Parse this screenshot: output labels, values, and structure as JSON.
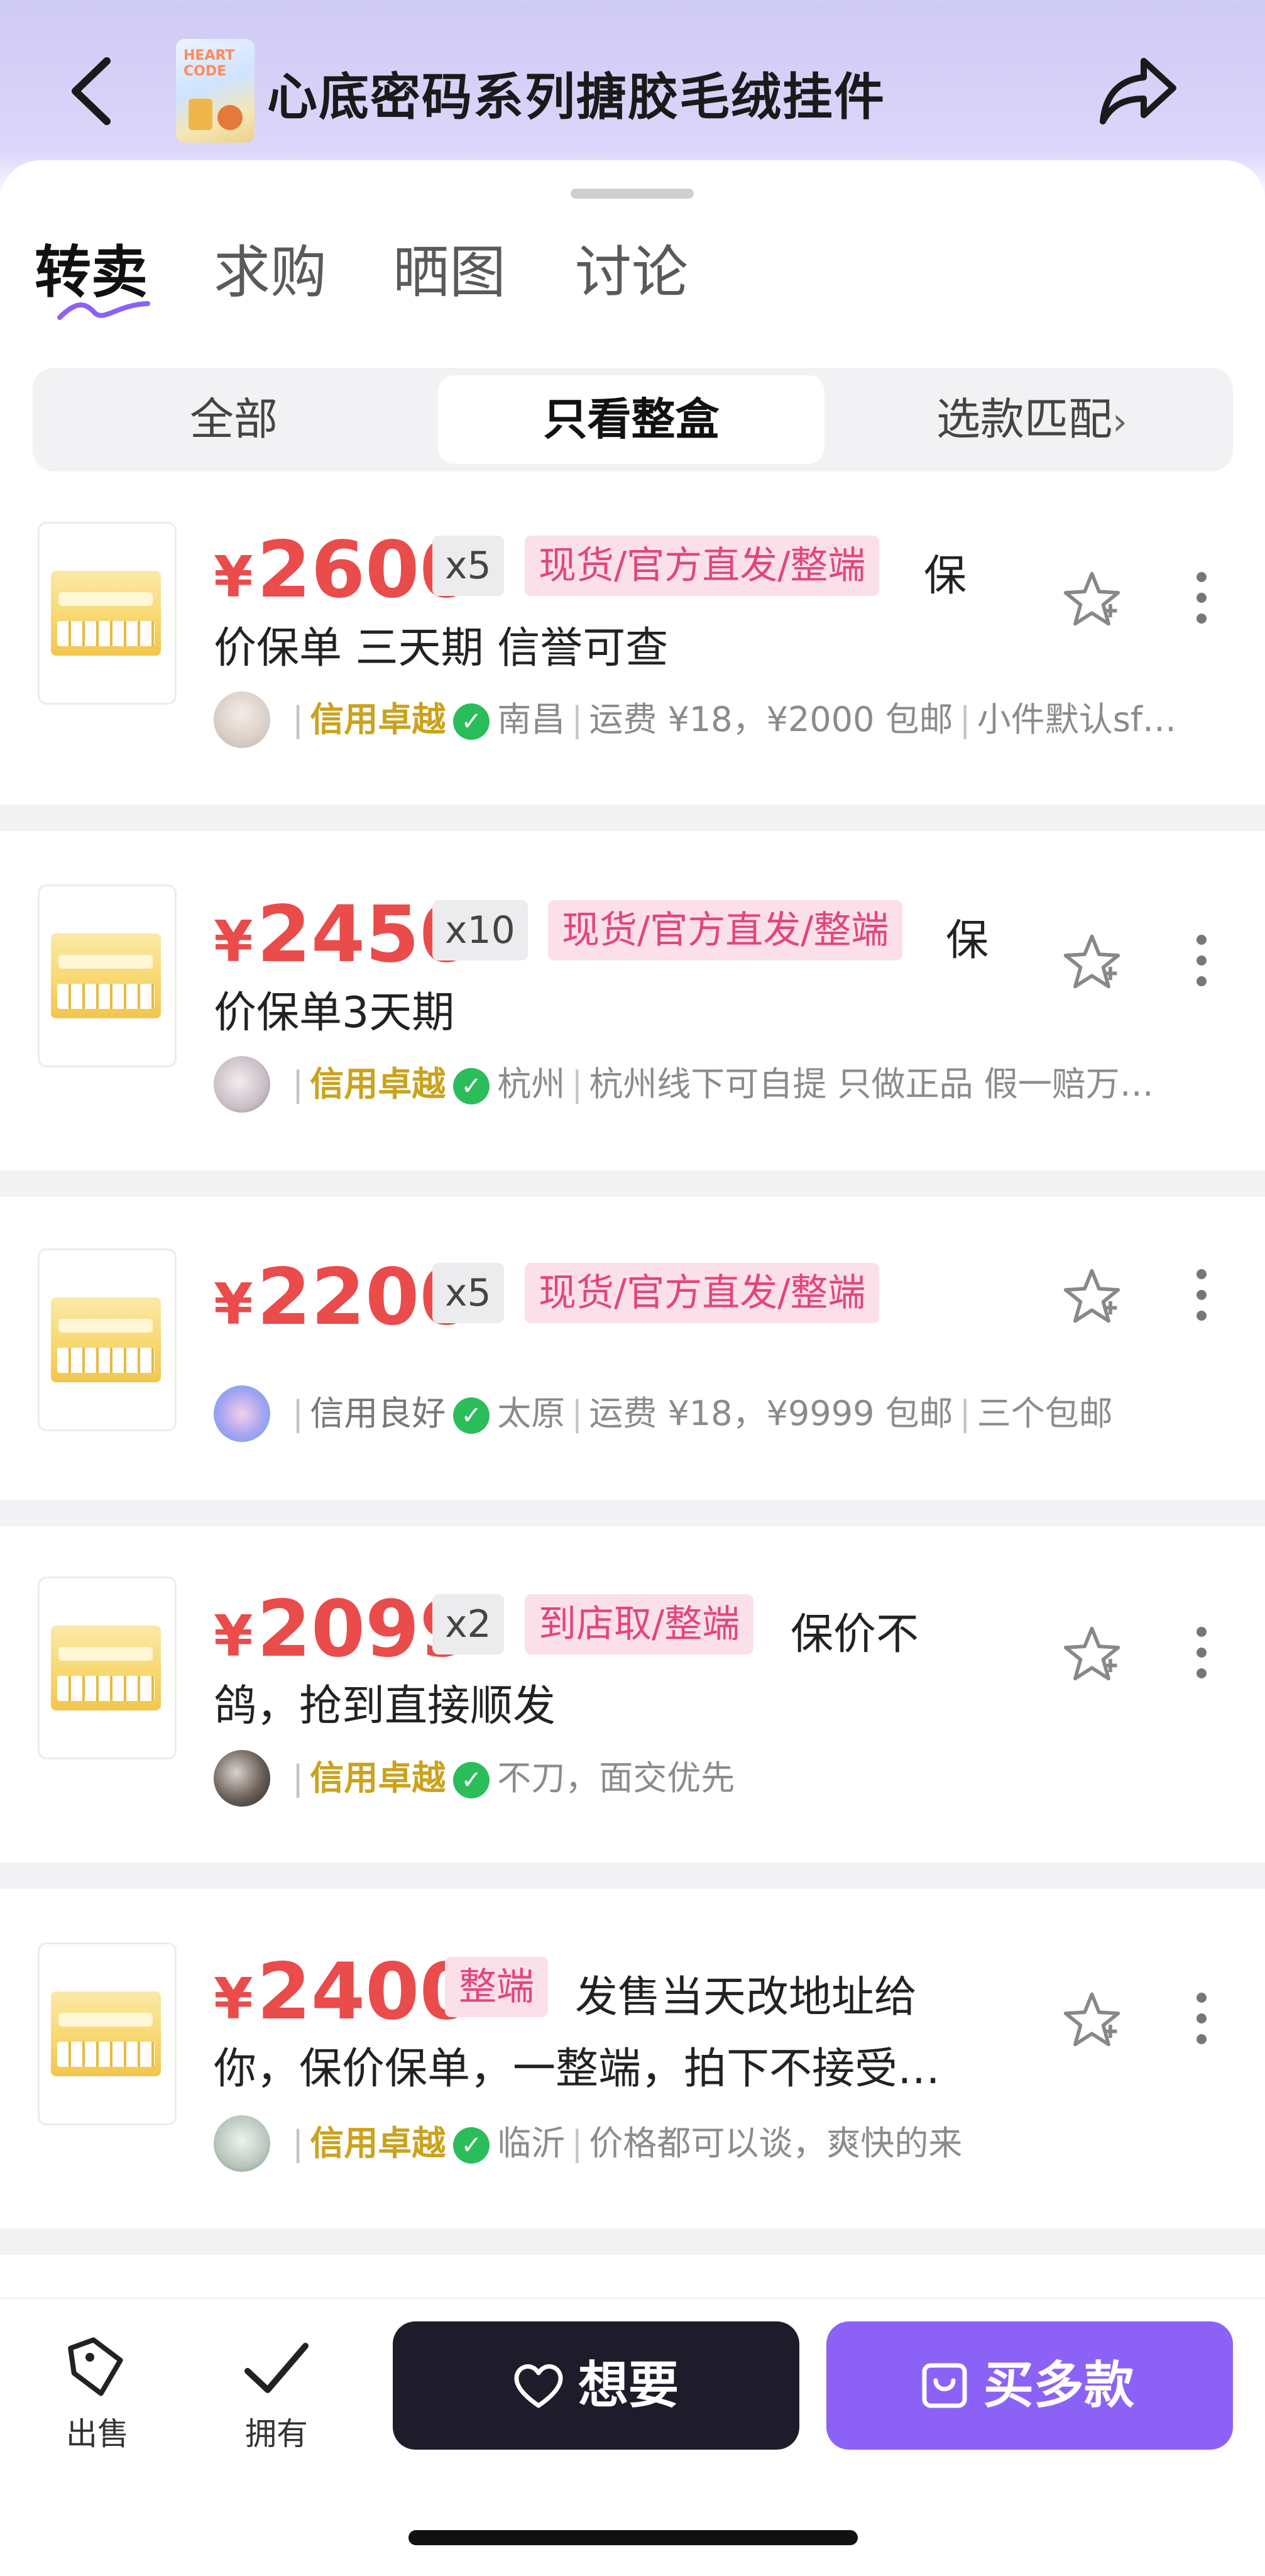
{
  "header": {
    "title": "心底密码系列搪胶毛绒挂件",
    "thumbnail_text": "HEART CODE"
  },
  "tabs": [
    {
      "label": "转卖",
      "active": true
    },
    {
      "label": "求购",
      "active": false
    },
    {
      "label": "晒图",
      "active": false
    },
    {
      "label": "讨论",
      "active": false
    }
  ],
  "filters": [
    {
      "label": "全部",
      "active": false
    },
    {
      "label": "只看整盒",
      "active": true
    },
    {
      "label": "选款匹配",
      "active": false,
      "chevron": "›"
    }
  ],
  "listings": [
    {
      "currency": "¥",
      "price": "2600",
      "qty": "x5",
      "tag": "现货/官方直发/整端",
      "desc_line1": "保",
      "desc_line2": "价保单 三天期 信誉可查",
      "credit": "信用卓越",
      "credit_level": "gold",
      "details": "南昌 | 运费 ¥18，¥2000 包邮 | 小件默认sf…"
    },
    {
      "currency": "¥",
      "price": "2450",
      "qty": "x10",
      "tag": "现货/官方直发/整端",
      "desc_line1": "保",
      "desc_line2": "价保单3天期",
      "credit": "信用卓越",
      "credit_level": "gold",
      "details": "杭州 | 杭州线下可自提 只做正品 假一赔万…"
    },
    {
      "currency": "¥",
      "price": "2200",
      "qty": "x5",
      "tag": "现货/官方直发/整端",
      "desc_line1": "",
      "desc_line2": "",
      "credit": "信用良好",
      "credit_level": "grey",
      "details": "太原 | 运费 ¥18，¥9999 包邮 | 三个包邮"
    },
    {
      "currency": "¥",
      "price": "2099",
      "qty": "x2",
      "tag": "到店取/整端",
      "desc_line1": "保价不",
      "desc_line2": "鸽，抢到直接顺发",
      "credit": "信用卓越",
      "credit_level": "gold",
      "details": "不刀，面交优先"
    },
    {
      "currency": "¥",
      "price": "2400",
      "qty": "",
      "tag": "整端",
      "desc_line1": "发售当天改地址给",
      "desc_line2": "你，保价保单，一整端，拍下不接受…",
      "credit": "信用卓越",
      "credit_level": "gold",
      "details": "临沂 | 价格都可以谈，爽快的来"
    }
  ],
  "bottom_bar": {
    "sell_label": "出售",
    "own_label": "拥有",
    "want_label": "想要",
    "buy_label": "买多款"
  },
  "colors": {
    "price": "#ea4b4b",
    "tag_text": "#e3457a",
    "tag_bg": "#fbe0ea",
    "credit_gold": "#caa21c",
    "verified": "#2bbd5a",
    "want_button": "#1e1b2b",
    "buy_button": "#8c62f6"
  }
}
